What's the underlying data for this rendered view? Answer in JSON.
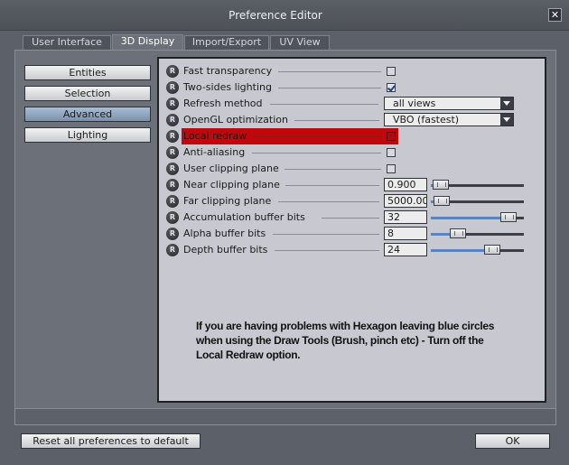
{
  "window": {
    "title": "Preference Editor",
    "close_label": "✕"
  },
  "tabs": [
    {
      "label": "User Interface",
      "active": false
    },
    {
      "label": "3D Display",
      "active": true
    },
    {
      "label": "Import/Export",
      "active": false
    },
    {
      "label": "UV View",
      "active": false
    }
  ],
  "sidebar": {
    "items": [
      {
        "label": "Entities",
        "active": false
      },
      {
        "label": "Selection",
        "active": false
      },
      {
        "label": "Advanced",
        "active": true
      },
      {
        "label": "Lighting",
        "active": false
      }
    ]
  },
  "reset_icon_label": "R",
  "settings": [
    {
      "label": "Fast transparency",
      "type": "checkbox",
      "checked": false
    },
    {
      "label": "Two-sides lighting",
      "type": "checkbox",
      "checked": true
    },
    {
      "label": "Refresh method",
      "type": "select",
      "value": "all views"
    },
    {
      "label": "OpenGL optimization",
      "type": "select",
      "value": "VBO (fastest)"
    },
    {
      "label": "Local redraw",
      "type": "checkbox",
      "checked": false,
      "highlighted": true,
      "highlight_color": "#c0080c"
    },
    {
      "label": "Anti-aliasing",
      "type": "checkbox",
      "checked": false
    },
    {
      "label": "User clipping plane",
      "type": "checkbox",
      "checked": false
    },
    {
      "label": "Near clipping plane",
      "type": "slider",
      "value": "0.900",
      "slider_level": 0.02
    },
    {
      "label": "Far clipping plane",
      "type": "slider",
      "value": "5000.00",
      "slider_level": 0.04
    },
    {
      "label": "Accumulation buffer bits",
      "type": "slider",
      "value": "32",
      "slider_level": 0.9
    },
    {
      "label": "Alpha buffer bits",
      "type": "slider",
      "value": "8",
      "slider_level": 0.25
    },
    {
      "label": "Depth buffer bits",
      "type": "slider",
      "value": "24",
      "slider_level": 0.7
    }
  ],
  "note": {
    "lines": [
      "If you are having problems with Hexagon leaving blue circles",
      "when using the Draw Tools (Brush, pinch etc) - Turn off the",
      "Local Redraw option."
    ]
  },
  "footer": {
    "reset_label": "Reset all preferences to default",
    "ok_label": "OK"
  },
  "colors": {
    "accent": "#4d86d1",
    "highlight": "#c0080c",
    "active_sidebar": "#7b92ac"
  }
}
